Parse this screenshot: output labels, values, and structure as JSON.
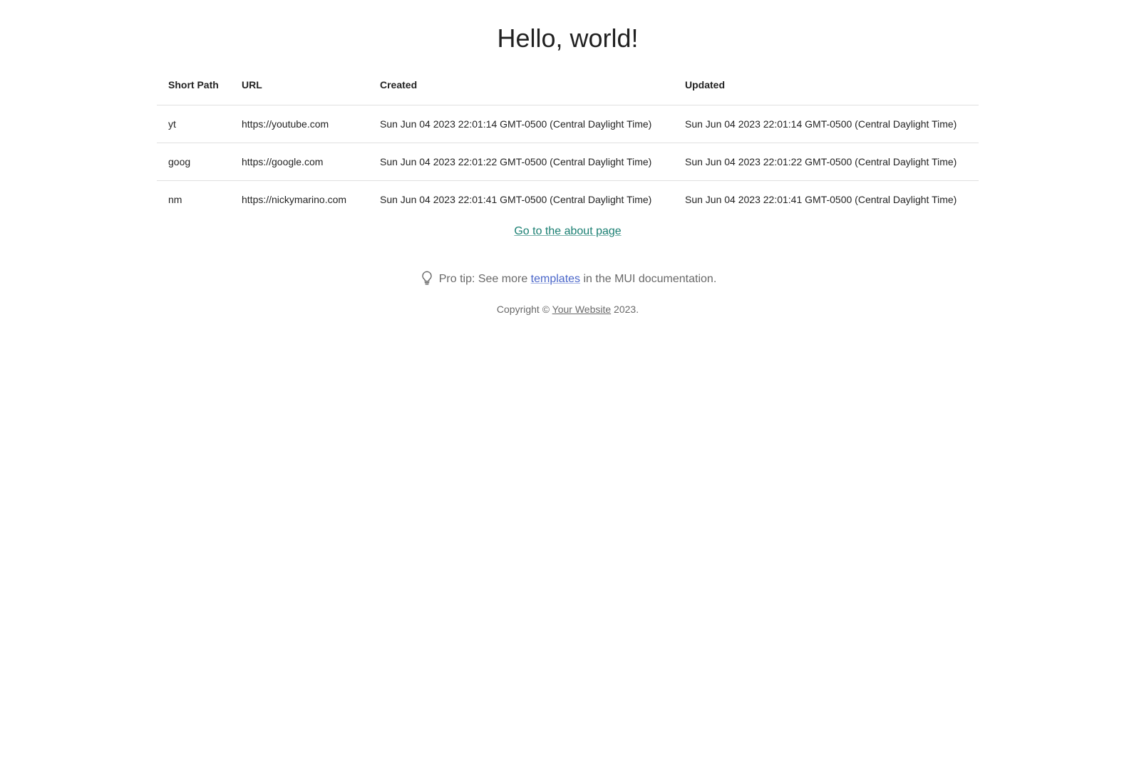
{
  "page": {
    "title": "Hello, world!"
  },
  "table": {
    "headers": [
      "Short Path",
      "URL",
      "Created",
      "Updated"
    ],
    "rows": [
      {
        "short_path": "yt",
        "url": "https://youtube.com",
        "created": "Sun Jun 04 2023 22:01:14 GMT-0500 (Central Daylight Time)",
        "updated": "Sun Jun 04 2023 22:01:14 GMT-0500 (Central Daylight Time)"
      },
      {
        "short_path": "goog",
        "url": "https://google.com",
        "created": "Sun Jun 04 2023 22:01:22 GMT-0500 (Central Daylight Time)",
        "updated": "Sun Jun 04 2023 22:01:22 GMT-0500 (Central Daylight Time)"
      },
      {
        "short_path": "nm",
        "url": "https://nickymarino.com",
        "created": "Sun Jun 04 2023 22:01:41 GMT-0500 (Central Daylight Time)",
        "updated": "Sun Jun 04 2023 22:01:41 GMT-0500 (Central Daylight Time)"
      }
    ]
  },
  "about_link": {
    "label": "Go to the about page"
  },
  "tip": {
    "icon": "lightbulb-icon",
    "prefix": "Pro tip: See more ",
    "link_label": "templates",
    "suffix": " in the MUI documentation."
  },
  "footer": {
    "prefix": "Copyright © ",
    "link_label": "Your Website",
    "suffix": " 2023."
  },
  "colors": {
    "primary_link": "#1a7f72",
    "tip_link": "#4a66c9",
    "divider": "#e0e0e0"
  }
}
